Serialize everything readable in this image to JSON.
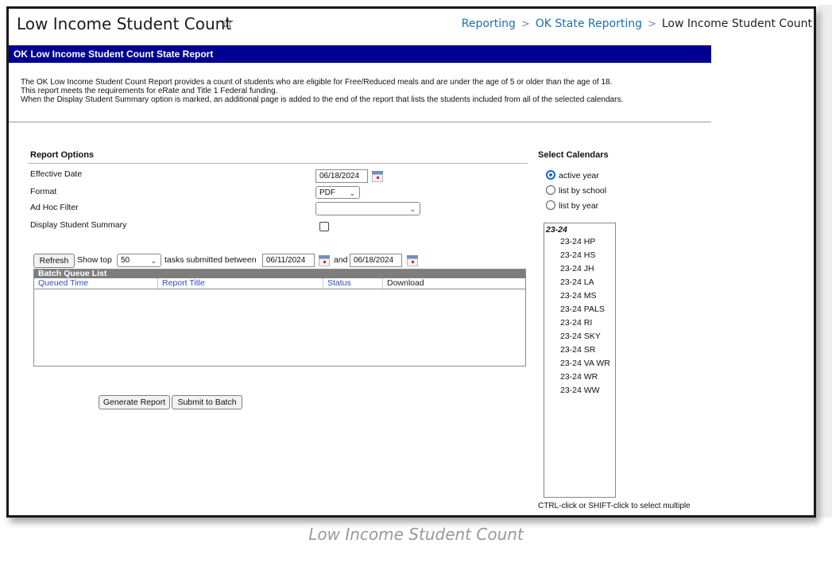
{
  "header": {
    "title": "Low Income Student Count",
    "star_icon": "star-outline-icon",
    "breadcrumb": [
      "Reporting",
      "OK State Reporting",
      "Low Income Student Count"
    ]
  },
  "banner": {
    "title": "OK Low Income Student Count State Report"
  },
  "description": {
    "line1": "The OK Low Income Student Count Report provides a count of students who are eligible for Free/Reduced meals and are under the age of 5 or older than the age of 18.",
    "line2": "This report meets the requirements for eRate and Title 1 Federal funding.",
    "line3": "When the Display Student Summary option is marked, an additional page is added to the end of the report that lists the students included from all of the selected calendars."
  },
  "report_options": {
    "heading": "Report Options",
    "effective_date_label": "Effective Date",
    "effective_date_value": "06/18/2024",
    "format_label": "Format",
    "format_value": "PDF",
    "ad_hoc_label": "Ad Hoc Filter",
    "ad_hoc_value": "",
    "display_summary_label": "Display Student Summary"
  },
  "batch": {
    "refresh": "Refresh",
    "show_top": "Show top",
    "top_value": "50",
    "tasks_between": "tasks submitted between",
    "start_date": "06/11/2024",
    "and": "and",
    "end_date": "06/18/2024",
    "list_title": "Batch Queue List",
    "columns": [
      "Queued Time",
      "Report Title",
      "Status",
      "Download"
    ]
  },
  "buttons": {
    "generate": "Generate Report",
    "submit": "Submit to Batch"
  },
  "calendars": {
    "heading": "Select Calendars",
    "radio_active": "active year",
    "radio_school": "list by school",
    "radio_year": "list by year",
    "group": "23-24",
    "items": [
      "23-24 HP",
      "23-24 HS",
      "23-24 JH",
      "23-24 LA",
      "23-24 MS",
      "23-24 PALS",
      "23-24 RI",
      "23-24 SKY",
      "23-24 SR",
      "23-24 VA WR",
      "23-24 WR",
      "23-24 WW"
    ],
    "hint": "CTRL-click or SHIFT-click to select multiple"
  },
  "caption": "Low Income Student Count"
}
